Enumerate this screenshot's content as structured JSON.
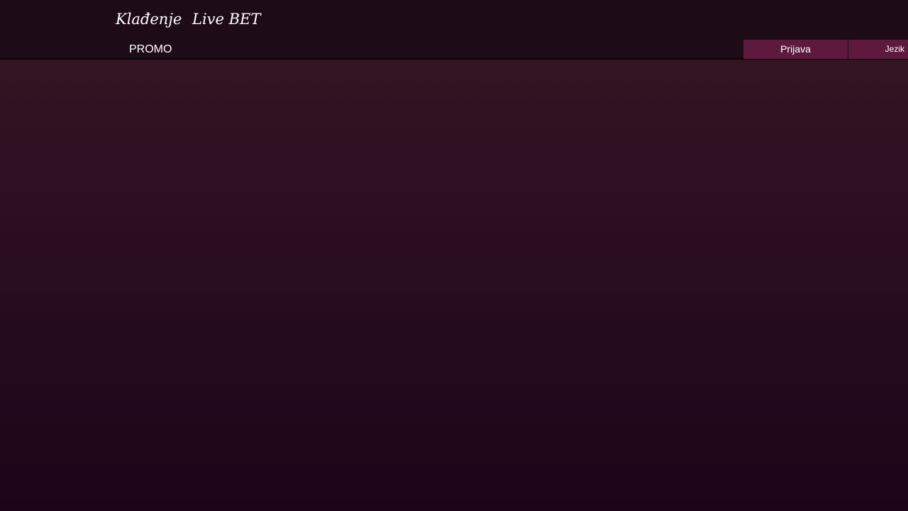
{
  "header": {
    "nav_main": [
      {
        "label": "Klađenje"
      },
      {
        "label": "Live BET"
      }
    ],
    "nav_secondary": [
      {
        "label": "PROMO"
      }
    ],
    "login_label": "Prijava",
    "language_label": "Jezik"
  },
  "colors": {
    "header_bg": "#1e0b18",
    "button_bg": "#5e1a3c",
    "page_gradient_top": "#351723",
    "page_gradient_bottom": "#1c0519"
  }
}
